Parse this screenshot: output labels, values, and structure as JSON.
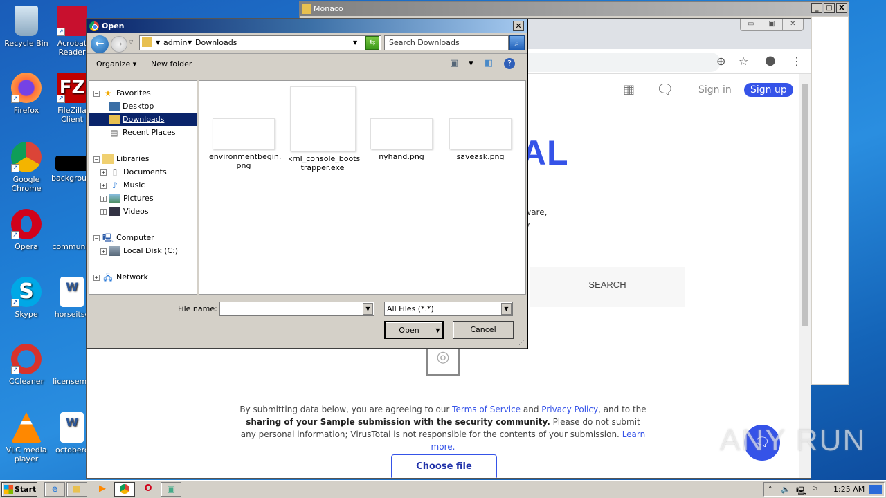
{
  "desktop": {
    "icons": [
      {
        "label": "Recycle Bin",
        "icon": "recycle-bin-icon"
      },
      {
        "label": "Acrobat Reader",
        "icon": "acrobat-icon"
      },
      {
        "label": "Firefox",
        "icon": "firefox-icon"
      },
      {
        "label": "FileZilla Client",
        "icon": "filezilla-icon"
      },
      {
        "label": "Google Chrome",
        "icon": "chrome-icon"
      },
      {
        "label": "background",
        "icon": "image-file-icon"
      },
      {
        "label": "Opera",
        "icon": "opera-icon"
      },
      {
        "label": "communic",
        "icon": "file-icon"
      },
      {
        "label": "Skype",
        "icon": "skype-icon"
      },
      {
        "label": "horseitse",
        "icon": "word-doc-icon"
      },
      {
        "label": "CCleaner",
        "icon": "ccleaner-icon"
      },
      {
        "label": "licensemo",
        "icon": "file-icon"
      },
      {
        "label": "VLC media player",
        "icon": "vlc-icon"
      },
      {
        "label": "octoberc",
        "icon": "word-doc-icon"
      }
    ]
  },
  "monaco_window": {
    "title": "Monaco"
  },
  "browser": {
    "header": {
      "signin": "Sign in",
      "signup": "Sign up"
    },
    "logo_fragment": "TAL",
    "desc_lines": [
      "malware,",
      "unity"
    ],
    "search_tab": "SEARCH",
    "legal": {
      "p1": "By submitting data below, you are agreeing to our ",
      "tos": "Terms of Service",
      "and": " and ",
      "privacy": "Privacy Policy",
      "p2": ", and to the",
      "bold": "sharing of your Sample submission with the security community.",
      "p3": " Please do not submit any personal information; VirusTotal is not responsible for the contents of your submission. ",
      "learn": "Learn more."
    },
    "choose_file": "Choose file",
    "accent": "#3553e8"
  },
  "dialog": {
    "title": "Open",
    "breadcrumb": [
      "admin",
      "Downloads"
    ],
    "search_placeholder": "Search Downloads",
    "organize": "Organize",
    "new_folder": "New folder",
    "tree": {
      "favorites": "Favorites",
      "desktop": "Desktop",
      "downloads": "Downloads",
      "recent": "Recent Places",
      "libraries": "Libraries",
      "documents": "Documents",
      "music": "Music",
      "pictures": "Pictures",
      "videos": "Videos",
      "computer": "Computer",
      "localdisk": "Local Disk (C:)",
      "network": "Network"
    },
    "files": [
      {
        "name": "environmentbegin.png",
        "line1": "environmentbegin.",
        "line2": "png"
      },
      {
        "name": "krnl_console_bootstrapper.exe",
        "line1": "krnl_console_boots",
        "line2": "trapper.exe"
      },
      {
        "name": "nyhand.png",
        "line1": "nyhand.png",
        "line2": ""
      },
      {
        "name": "saveask.png",
        "line1": "saveask.png",
        "line2": ""
      }
    ],
    "filename_label": "File name:",
    "filename_value": "",
    "filter": "All Files (*.*)",
    "open": "Open",
    "cancel": "Cancel"
  },
  "taskbar": {
    "start": "Start",
    "clock": "1:25 AM"
  },
  "watermark": "ANY RUN"
}
